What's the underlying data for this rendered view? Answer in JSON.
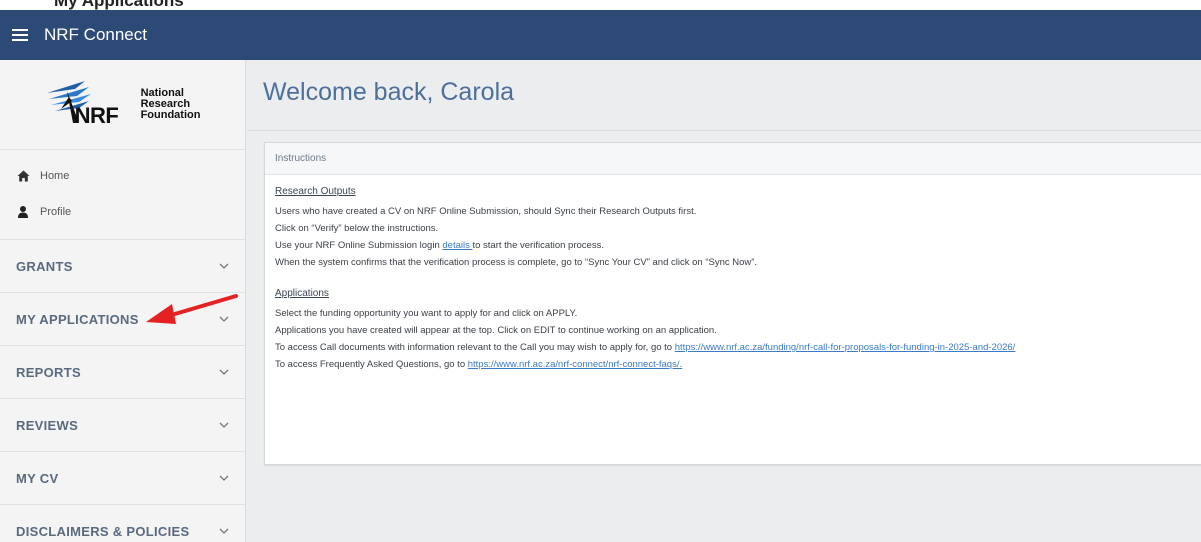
{
  "page_top": {
    "cropped_title": "My Applications"
  },
  "topbar": {
    "title": "NRF Connect"
  },
  "logo": {
    "mark": "NRF",
    "lines": [
      "National",
      "Research",
      "Foundation"
    ]
  },
  "nav": {
    "home": "Home",
    "profile": "Profile"
  },
  "sections": [
    {
      "label": "GRANTS"
    },
    {
      "label": "MY APPLICATIONS"
    },
    {
      "label": "REPORTS"
    },
    {
      "label": "REVIEWS"
    },
    {
      "label": "MY CV"
    },
    {
      "label": "DISCLAIMERS & POLICIES"
    }
  ],
  "main": {
    "welcome": "Welcome back, Carola",
    "card_title": "Instructions",
    "research": {
      "title": "Research Outputs",
      "line1": "Users who have created a CV on NRF Online Submission, should Sync their Research Outputs first.",
      "line2": "Click on “Verify” below the instructions.",
      "line3_pre": "Use your NRF Online Submission login ",
      "line3_link": "details ",
      "line3_post": "to start the verification process.",
      "line4": "When the system confirms that the verification process is complete, go to “Sync Your CV” and click on “Sync Now”."
    },
    "applications": {
      "title": "Applications",
      "line1": "Select the funding opportunity you want to apply for and click on APPLY.",
      "line2": "Applications you have created will appear at the top.  Click on EDIT to continue working on an application.",
      "line3_pre": "To access Call documents with information relevant to the Call you may wish to apply for, go to  ",
      "line3_link": "https://www.nrf.ac.za/funding/nrf-call-for-proposals-for-funding-in-2025-and-2026/",
      "line4_pre": "To access Frequently Asked Questions, go to ",
      "line4_link": "https://www.nrf.ac.za/nrf-connect/nrf-connect-faqs/."
    }
  },
  "colors": {
    "topbar": "#2d4a76",
    "welcome": "#4d6f9c",
    "arrow": "#e52222",
    "link": "#3b7bc4"
  }
}
